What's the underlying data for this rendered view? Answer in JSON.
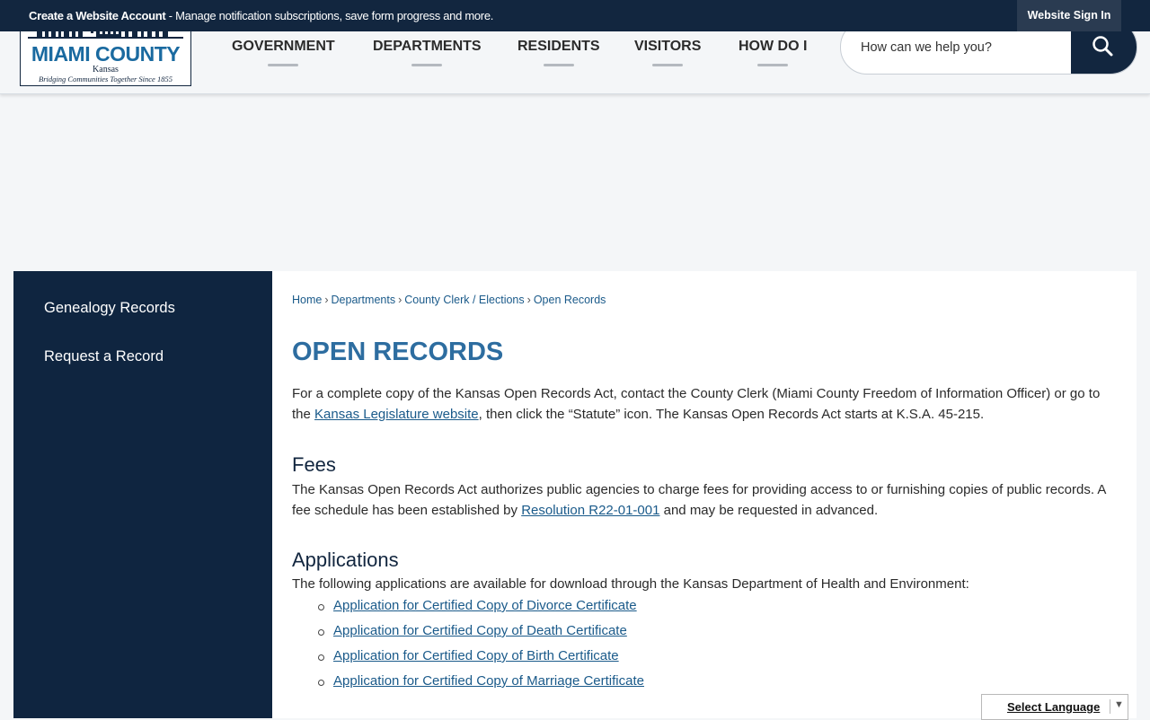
{
  "topbar": {
    "message_bold": "Create a Website Account",
    "message_rest": " - Manage notification subscriptions, save form progress and more.",
    "sign_in": "Website Sign In"
  },
  "logo": {
    "name": "MIAMI COUNTY",
    "state": "Kansas",
    "tagline": "Bridging Communities Together Since 1855"
  },
  "nav": {
    "government": "GOVERNMENT",
    "departments": "DEPARTMENTS",
    "residents": "RESIDENTS",
    "visitors": "VISITORS",
    "how_do_i": "HOW DO I"
  },
  "search": {
    "placeholder": "How can we help you?",
    "icon": "search-icon"
  },
  "sidebar": {
    "items": [
      {
        "label": "Genealogy Records"
      },
      {
        "label": "Request a Record"
      }
    ]
  },
  "breadcrumb": {
    "home": "Home",
    "departments": "Departments",
    "clerk": "County Clerk / Elections",
    "current": "Open Records",
    "separator": "›"
  },
  "page": {
    "title": "OPEN RECORDS",
    "intro_before": "For a complete copy of the Kansas Open Records Act, contact the County Clerk (Miami County Freedom of Information Officer) or go to the ",
    "intro_link": "Kansas Legislature website",
    "intro_after": ", then click the “Statute” icon. The Kansas Open Records Act starts at K.S.A. 45-215.",
    "fees_heading": "Fees",
    "fees_before": "The Kansas Open Records Act authorizes public agencies to charge fees for providing access to or furnishing copies of public records. A fee schedule has been established by ",
    "fees_link": "Resolution R22-01-001",
    "fees_after": " and may be requested in advanced.",
    "apps_heading": "Applications",
    "apps_intro": "The following applications are available for download through the Kansas Department of Health and Environment:",
    "applications": [
      "Application for Certified Copy of Divorce Certificate",
      "Application for Certified Copy of Death Certificate",
      "Application for Certified Copy of Birth Certificate",
      "Application for Certified Copy of Marriage Certificate"
    ]
  },
  "language": {
    "label": "Select Language",
    "arrow": "▼"
  }
}
